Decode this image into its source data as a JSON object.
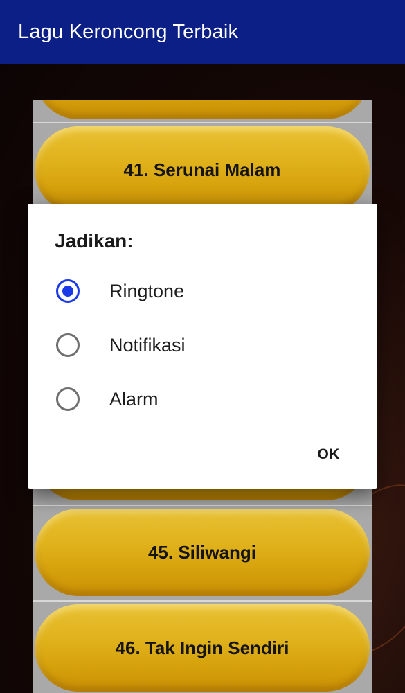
{
  "app_bar": {
    "title": "Lagu Keroncong Terbaik"
  },
  "songs": [
    {
      "label": ""
    },
    {
      "label": "41. Serunai Malam"
    },
    {
      "label": ""
    },
    {
      "label": "45. Siliwangi"
    },
    {
      "label": "46. Tak Ingin Sendiri"
    }
  ],
  "dialog": {
    "title": "Jadikan:",
    "options": [
      {
        "label": "Ringtone",
        "checked": true
      },
      {
        "label": "Notifikasi",
        "checked": false
      },
      {
        "label": "Alarm",
        "checked": false
      }
    ],
    "ok_label": "OK"
  },
  "colors": {
    "app_bar": "#0b1f86",
    "accent": "#1a3ae8",
    "button_gold": "#e0b21c"
  }
}
